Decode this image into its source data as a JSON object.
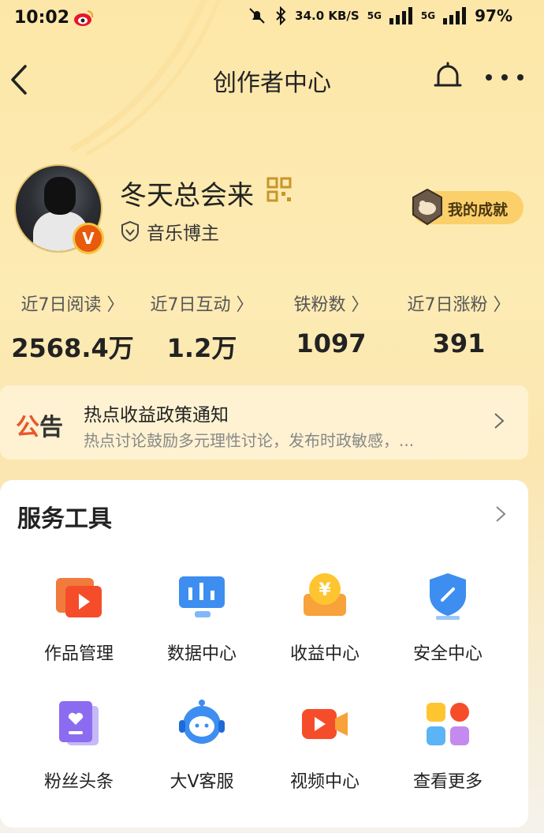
{
  "status_bar": {
    "time": "10:02",
    "network_speed": "34.0 KB/S",
    "net1": "5G",
    "net2": "5G",
    "battery": "97%",
    "icons": [
      "weibo-icon",
      "mute-icon",
      "bluetooth-icon",
      "signal-icon",
      "battery-icon"
    ]
  },
  "nav": {
    "title": "创作者中心",
    "icons": [
      "back-icon",
      "bell-icon",
      "more-icon"
    ]
  },
  "profile": {
    "name": "冬天总会来",
    "verify_label": "音乐博主",
    "vip_badge": "V",
    "achievement_label": "我的成就"
  },
  "stats": [
    {
      "label": "近7日阅读",
      "value": "2568.4万"
    },
    {
      "label": "近7日互动",
      "value": "1.2万"
    },
    {
      "label": "铁粉数",
      "value": "1097"
    },
    {
      "label": "近7日涨粉",
      "value": "391"
    }
  ],
  "notice": {
    "tag_a": "公",
    "tag_b": "告",
    "title": "热点收益政策通知",
    "text": "热点讨论鼓励多元理性讨论，发布时政敏感，..."
  },
  "tools": {
    "heading": "服务工具",
    "items": [
      {
        "label": "作品管理",
        "icon": "works-icon"
      },
      {
        "label": "数据中心",
        "icon": "data-icon"
      },
      {
        "label": "收益中心",
        "icon": "income-icon"
      },
      {
        "label": "安全中心",
        "icon": "security-icon"
      },
      {
        "label": "粉丝头条",
        "icon": "fans-headline-icon"
      },
      {
        "label": "大V客服",
        "icon": "customer-service-icon"
      },
      {
        "label": "视频中心",
        "icon": "video-icon"
      },
      {
        "label": "查看更多",
        "icon": "more-apps-icon"
      }
    ]
  },
  "colors": {
    "accent_orange": "#e8562a",
    "gold": "#f6c23e",
    "blue": "#3d8ef0",
    "purple": "#8b6cf0"
  }
}
